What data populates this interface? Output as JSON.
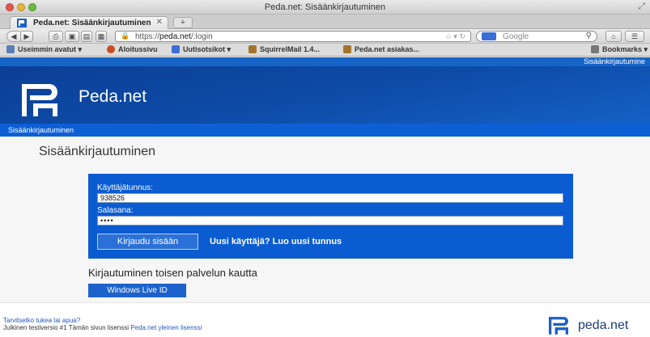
{
  "window": {
    "title": "Peda.net: Sisäänkirjautuminen"
  },
  "tabs": [
    {
      "label": "Peda.net: Sisäänkirjautuminen"
    }
  ],
  "newtab": {
    "label": "+"
  },
  "address_bar": {
    "scheme": "https://",
    "host": "peda.net",
    "path": "/:login"
  },
  "search_bar": {
    "placeholder": "Google"
  },
  "bookmarks": [
    {
      "label": "Useimmin avatut ▾"
    },
    {
      "label": "Aloitussivu"
    },
    {
      "label": "Uutisotsikot ▾"
    },
    {
      "label": "SquirrelMail 1.4..."
    },
    {
      "label": "Peda.net asiakas..."
    },
    {
      "label": "Bookmarks ▾"
    }
  ],
  "page": {
    "util_link": "Sisäänkirjautumine",
    "brand": "Peda.net",
    "breadcrumb": "Sisäänkirjautuminen",
    "title": "Sisäänkirjautuminen",
    "login": {
      "username_label": "Käyttäjätunnus:",
      "username_value": "938526",
      "password_label": "Salasana:",
      "password_value": "••••",
      "submit_label": "Kirjaudu sisään",
      "register_link": "Uusi käyttäjä? Luo uusi tunnus"
    },
    "alt_login": {
      "title": "Kirjautuminen toisen palvelun kautta",
      "windows_live_button": "Windows Live ID"
    },
    "footer": {
      "help_link": "Tarvitsetko tukea tai apua?",
      "license_prefix": "Julkinen testiversio #1 Tämän sivun lisenssi",
      "license_link": "Peda.net yleinen lisenssi",
      "brand": "peda.net"
    }
  },
  "colors": {
    "header_dark": "#0c3f96",
    "brand_blue": "#0b5bd1",
    "link_blue": "#2457b8"
  }
}
